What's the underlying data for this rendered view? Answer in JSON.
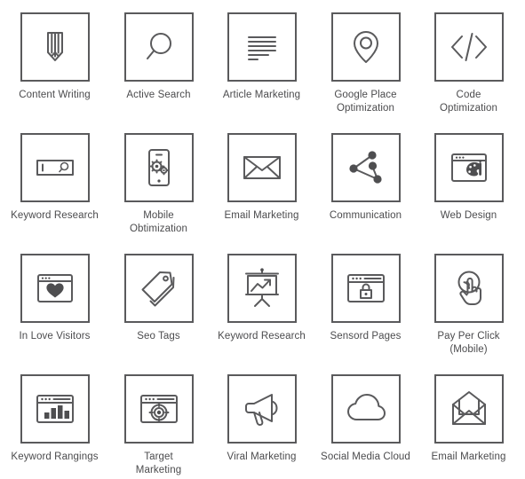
{
  "page": {
    "title": "SEO Marketing Icon Set",
    "columns": 5,
    "rows": 4,
    "tile_border_color": "#5a5a5c",
    "icon_color": "#5a5a5c",
    "label_color": "#4b4b4d",
    "background_color": "#ffffff"
  },
  "items": [
    {
      "label": "Content Writing",
      "icon": "pencil-icon"
    },
    {
      "label": "Active Search",
      "icon": "magnifier-icon"
    },
    {
      "label": "Article Marketing",
      "icon": "text-lines-icon"
    },
    {
      "label": "Google Place\nOptimization",
      "icon": "map-pin-icon"
    },
    {
      "label": "Code\nOptimization",
      "icon": "code-brackets-icon"
    },
    {
      "label": "Keyword Research",
      "icon": "search-field-icon"
    },
    {
      "label": "Mobile\nObtimization",
      "icon": "phone-gears-icon"
    },
    {
      "label": "Email Marketing",
      "icon": "envelope-icon"
    },
    {
      "label": "Communication",
      "icon": "network-nodes-icon"
    },
    {
      "label": "Web Design",
      "icon": "browser-palette-icon"
    },
    {
      "label": "In Love Visitors",
      "icon": "browser-heart-icon"
    },
    {
      "label": "Seo Tags",
      "icon": "price-tags-icon"
    },
    {
      "label": "Keyword Research",
      "icon": "presentation-chart-icon"
    },
    {
      "label": "Sensord Pages",
      "icon": "browser-lock-icon"
    },
    {
      "label": "Pay Per Click\n(Mobile)",
      "icon": "tap-hand-icon"
    },
    {
      "label": "Keyword Rangings",
      "icon": "browser-bar-chart-icon"
    },
    {
      "label": "Target\nMarketing",
      "icon": "browser-target-icon"
    },
    {
      "label": "Viral Marketing",
      "icon": "megaphone-icon"
    },
    {
      "label": "Social Media Cloud",
      "icon": "cloud-icon"
    },
    {
      "label": "Email Marketing",
      "icon": "open-envelope-icon"
    }
  ]
}
